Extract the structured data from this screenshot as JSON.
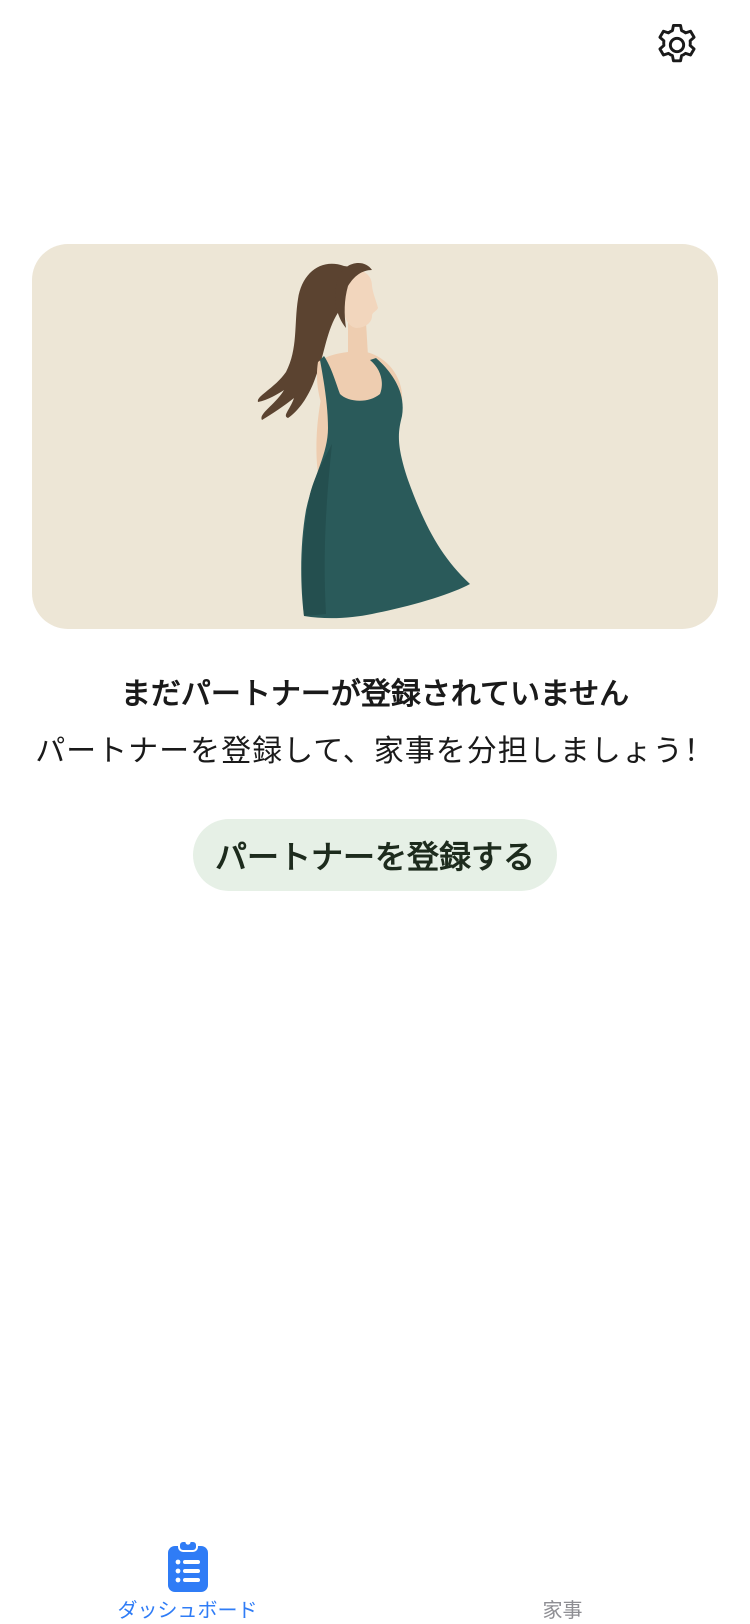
{
  "header": {
    "settings_icon": "gear-icon"
  },
  "hero": {
    "illustration": "woman-in-green-dress-illustration",
    "background_color": "#ede6d6"
  },
  "empty_state": {
    "title": "まだパートナーが登録されていません",
    "subtitle": "パートナーを登録して、家事を分担しましょう！",
    "register_button_label": "パートナーを登録する"
  },
  "tabbar": {
    "active_color": "#2f7cf6",
    "inactive_color": "#8e8e93",
    "tabs": [
      {
        "label": "ダッシュボード",
        "icon": "clipboard-list-icon",
        "active": true
      },
      {
        "label": "家事",
        "icon": "",
        "active": false
      }
    ]
  }
}
